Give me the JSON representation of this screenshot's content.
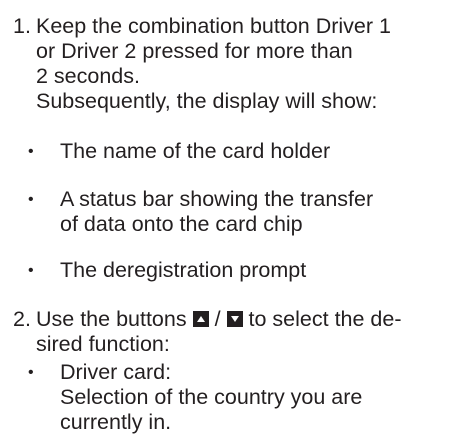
{
  "steps": [
    {
      "number": "1.",
      "lines": [
        "Keep the combination button Driver 1",
        "or Driver 2 pressed for more than",
        "2 seconds.",
        "Subsequently, the display will show:"
      ],
      "bullets": [
        {
          "lines": [
            "The name of the card holder"
          ]
        },
        {
          "lines": [
            "A status bar showing the transfer",
            "of data onto the card chip"
          ]
        },
        {
          "lines": [
            "The deregistration prompt"
          ]
        }
      ]
    },
    {
      "number": "2.",
      "line1_before": "Use the buttons",
      "line1_separator": "/",
      "line1_after": "to select the de-",
      "line2": "sired function:",
      "icons": [
        "up-arrow-button-icon",
        "down-arrow-button-icon"
      ],
      "bullets": [
        {
          "lines": [
            "Driver card:",
            "Selection of the country you are",
            "currently in."
          ]
        }
      ]
    }
  ],
  "bullet_glyph": "•"
}
